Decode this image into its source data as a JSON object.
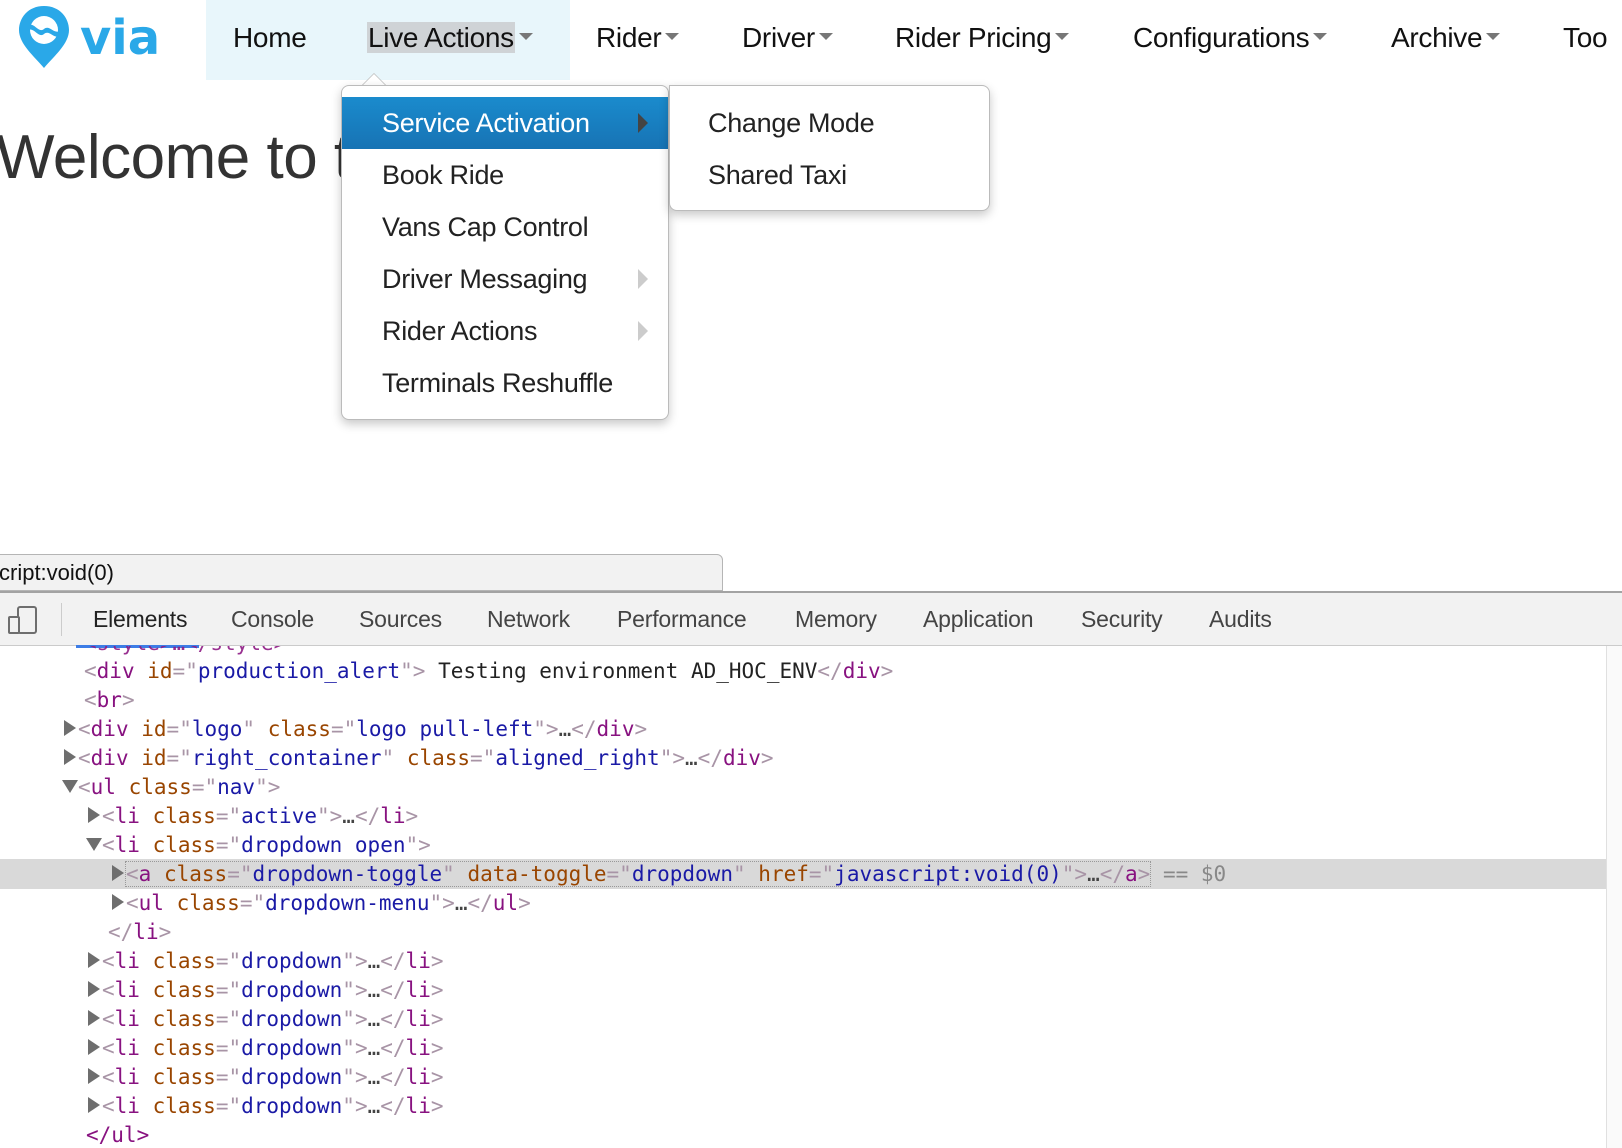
{
  "nav": {
    "brand": "via",
    "items": [
      {
        "label": "Home",
        "has_caret": false
      },
      {
        "label": "Live Actions",
        "has_caret": true,
        "open": true
      },
      {
        "label": "Rider",
        "has_caret": true
      },
      {
        "label": "Driver",
        "has_caret": true
      },
      {
        "label": "Rider Pricing",
        "has_caret": true
      },
      {
        "label": "Configurations",
        "has_caret": true
      },
      {
        "label": "Archive",
        "has_caret": true
      },
      {
        "label": "Too",
        "has_caret": false
      }
    ]
  },
  "welcome": "Welcome to t",
  "dropdown": {
    "items": [
      {
        "label": "Service Activation",
        "active": true,
        "has_submenu": true
      },
      {
        "label": "Book Ride",
        "has_submenu": false
      },
      {
        "label": "Vans Cap Control",
        "has_submenu": false
      },
      {
        "label": "Driver Messaging",
        "has_submenu": true
      },
      {
        "label": "Rider Actions",
        "has_submenu": true
      },
      {
        "label": "Terminals Reshuffle",
        "has_submenu": false
      }
    ],
    "submenu": [
      {
        "label": "Change Mode"
      },
      {
        "label": "Shared Taxi"
      }
    ]
  },
  "status_bar": "cript:void(0)",
  "devtools": {
    "tabs": [
      "Elements",
      "Console",
      "Sources",
      "Network",
      "Performance",
      "Memory",
      "Application",
      "Security",
      "Audits"
    ],
    "active_tab": "Elements",
    "dom": {
      "partial_top": "<style>…</style>",
      "line1": {
        "tag": "div",
        "attr1": "id",
        "val1": "production_alert",
        "text": " Testing environment AD_HOC_ENV"
      },
      "line2": {
        "tag": "br"
      },
      "line3": {
        "tag": "div",
        "attr1": "id",
        "val1": "logo",
        "attr2": "class",
        "val2": "logo pull-left"
      },
      "line4": {
        "tag": "div",
        "attr1": "id",
        "val1": "right_container",
        "attr2": "class",
        "val2": "aligned_right"
      },
      "line5": {
        "tag": "ul",
        "attr1": "class",
        "val1": "nav"
      },
      "line6": {
        "tag": "li",
        "attr1": "class",
        "val1": "active"
      },
      "line7": {
        "tag": "li",
        "attr1": "class",
        "val1": "dropdown open"
      },
      "line8": {
        "tag": "a",
        "attr1": "class",
        "val1": "dropdown-toggle",
        "attr2": "data-toggle",
        "val2": "dropdown",
        "attr3": "href",
        "val3": "javascript:void(0)",
        "marker": "== $0"
      },
      "line9": {
        "tag": "ul",
        "attr1": "class",
        "val1": "dropdown-menu"
      },
      "line10": {
        "close": "li"
      },
      "dropdown_items": [
        {
          "tag": "li",
          "attr1": "class",
          "val1": "dropdown"
        },
        {
          "tag": "li",
          "attr1": "class",
          "val1": "dropdown"
        },
        {
          "tag": "li",
          "attr1": "class",
          "val1": "dropdown"
        },
        {
          "tag": "li",
          "attr1": "class",
          "val1": "dropdown"
        },
        {
          "tag": "li",
          "attr1": "class",
          "val1": "dropdown"
        },
        {
          "tag": "li",
          "attr1": "class",
          "val1": "dropdown"
        }
      ],
      "last_partial": "</ul>",
      "ellipsis": "…"
    }
  },
  "colors": {
    "brand": "#2aa8e8",
    "menu_active": "#1a7fc1",
    "nav_highlight_bg": "#e8f6fb",
    "devtools_tab_underline": "#3d7de6"
  }
}
